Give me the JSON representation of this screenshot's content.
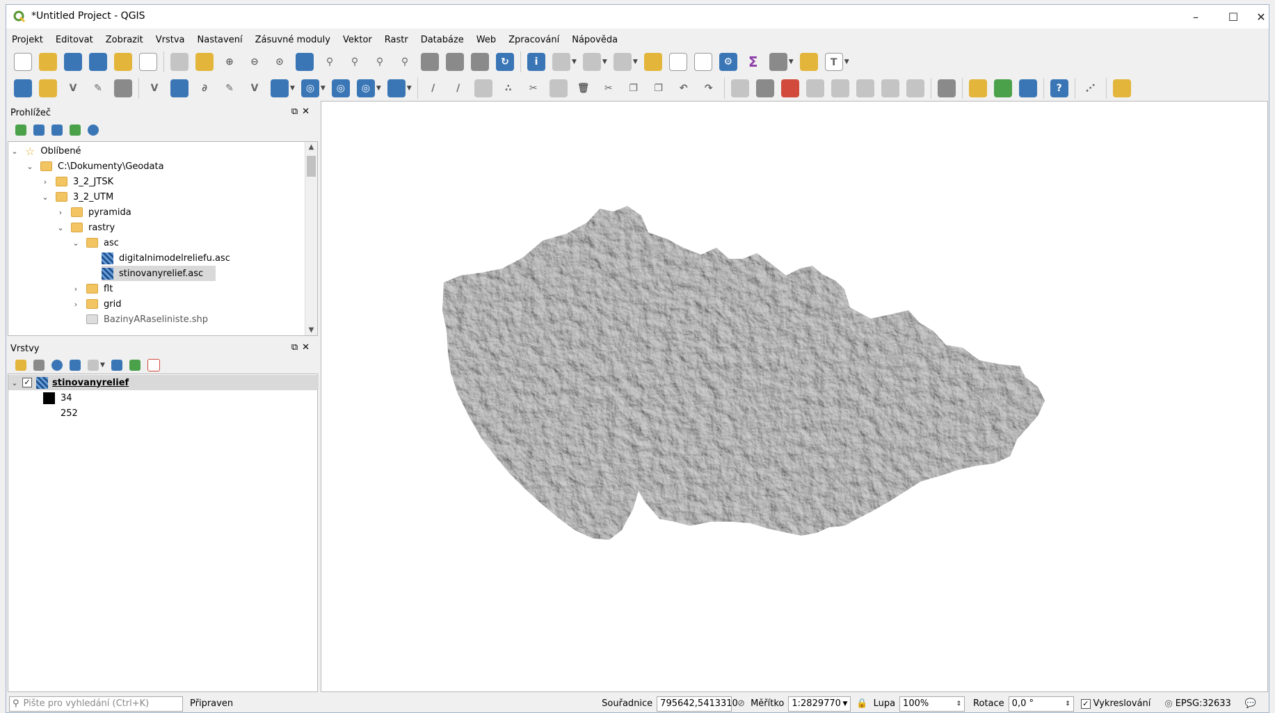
{
  "window": {
    "title": "*Untitled Project - QGIS",
    "minimize": "–",
    "maximize": "☐",
    "close": "✕"
  },
  "menu": [
    "Projekt",
    "Editovat",
    "Zobrazit",
    "Vrstva",
    "Nastavení",
    "Zásuvné moduly",
    "Vektor",
    "Rastr",
    "Databáze",
    "Web",
    "Zpracování",
    "Nápověda"
  ],
  "browser": {
    "title": "Prohlížeč",
    "items": {
      "favorites": "Oblíbené",
      "root": "C:\\Dokumenty\\Geodata",
      "jtsk": "3_2_JTSK",
      "utm": "3_2_UTM",
      "pyramida": "pyramida",
      "rastry": "rastry",
      "asc": "asc",
      "dmr": "digitalnimodelreliefu.asc",
      "stin": "stinovanyrelief.asc",
      "flt": "flt",
      "grid": "grid",
      "bazin": "BazinyARaseliniste.shp"
    }
  },
  "layers": {
    "title": "Vrstvy",
    "layer_name": "stinovanyrelief",
    "legend_min": "34",
    "legend_max": "252",
    "colors": {
      "min": "#000000",
      "max": "#ffffff"
    }
  },
  "status": {
    "search_placeholder": "Pište pro vyhledání (Ctrl+K)",
    "ready": "Připraven",
    "coord_label": "Souřadnice",
    "coord_value": "795642,5413310",
    "scale_label": "Měřítko",
    "scale_value": "1:2829770",
    "zoom_label": "Lupa",
    "zoom_value": "100%",
    "rotation_label": "Rotace",
    "rotation_value": "0,0 °",
    "render_label": "Vykreslování",
    "crs": "EPSG:32633"
  },
  "map": {
    "raster_color": "#a8a8a8"
  }
}
